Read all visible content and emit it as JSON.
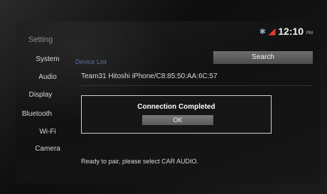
{
  "header": {
    "title": "Setting",
    "time": "12:10",
    "ampm": "PM"
  },
  "sidebar": {
    "items": [
      {
        "label": "System"
      },
      {
        "label": "Audio"
      },
      {
        "label": "Display"
      },
      {
        "label": "Bluetooth"
      },
      {
        "label": "Wi-Fi"
      },
      {
        "label": "Camera"
      }
    ]
  },
  "main": {
    "device_list_label": "Device List",
    "search_label": "Search",
    "device_name": "Team31 Hitoshi iPhone/C8:85:50:AA:6C:57",
    "status_message": "Ready to pair, please select CAR AUDIO."
  },
  "dialog": {
    "title": "Connection Completed",
    "ok_label": "OK"
  }
}
